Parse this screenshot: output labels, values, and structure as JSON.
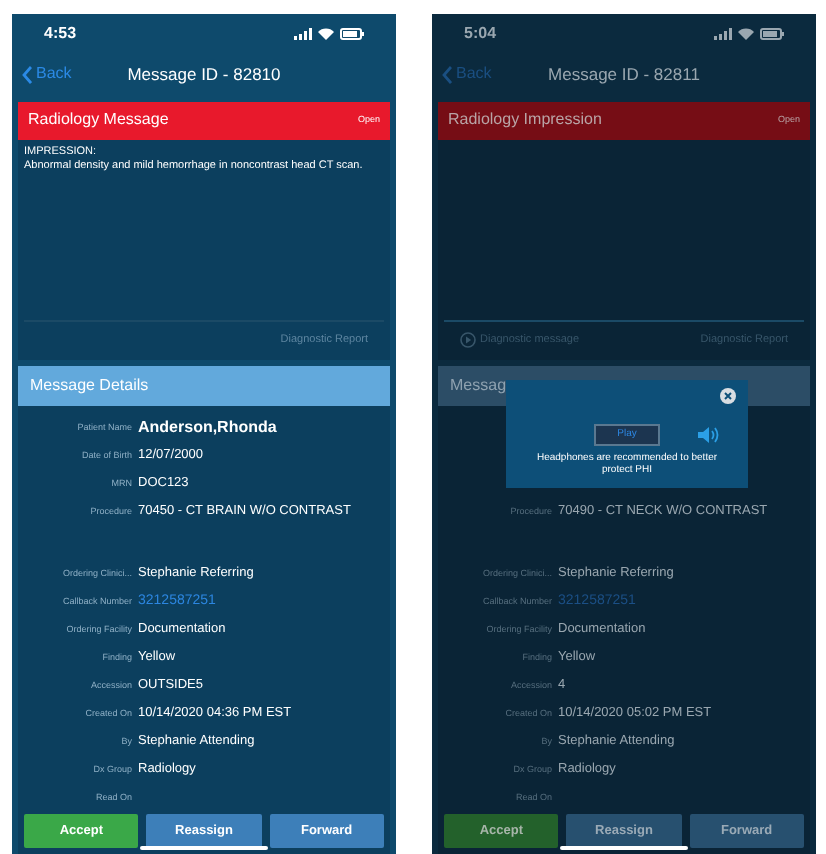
{
  "phones": [
    {
      "dimmed": false,
      "status_time": "4:53",
      "back_label": "Back",
      "title": "Message ID - 82810",
      "alert": {
        "title": "Radiology Message",
        "status": "Open"
      },
      "body_lines": [
        "IMPRESSION:",
        "Abnormal density and mild hemorrhage in noncontrast head CT scan."
      ],
      "footer_links": [
        {
          "kind": "report",
          "label": "Diagnostic Report"
        }
      ],
      "details_title": "Message Details",
      "detail_groups": [
        [
          {
            "kind": "name",
            "label": "Patient Name",
            "value": "Anderson,Rhonda"
          },
          {
            "kind": "text",
            "label": "Date of Birth",
            "value": "12/07/2000"
          },
          {
            "kind": "text",
            "label": "MRN",
            "value": "DOC123"
          },
          {
            "kind": "text",
            "label": "Procedure",
            "value": "70450 - CT BRAIN W/O CONTRAST"
          }
        ],
        [
          {
            "kind": "text",
            "label": "Ordering Clinici...",
            "value": "Stephanie Referring"
          },
          {
            "kind": "link",
            "label": "Callback Number",
            "value": "3212587251"
          },
          {
            "kind": "text",
            "label": "Ordering Facility",
            "value": "Documentation"
          },
          {
            "kind": "text",
            "label": "Finding",
            "value": "Yellow"
          },
          {
            "kind": "text",
            "label": "Accession",
            "value": "OUTSIDE5"
          },
          {
            "kind": "text",
            "label": "Created On",
            "value": "10/14/2020 04:36 PM EST"
          },
          {
            "kind": "text",
            "label": "By",
            "value": "Stephanie Attending"
          },
          {
            "kind": "text",
            "label": "Dx Group",
            "value": "Radiology"
          },
          {
            "kind": "text",
            "label": "Read On"
          }
        ]
      ],
      "buttons": [
        {
          "kind": "accept",
          "label": "Accept"
        },
        {
          "kind": "action",
          "label": "Reassign"
        },
        {
          "kind": "action",
          "label": "Forward"
        }
      ]
    },
    {
      "dimmed": true,
      "status_time": "5:04",
      "back_label": "Back",
      "title": "Message ID - 82811",
      "alert": {
        "title": "Radiology Impression",
        "status": "Open"
      },
      "footer_links": [
        {
          "kind": "audio",
          "label": "Diagnostic message"
        },
        {
          "kind": "report",
          "label": "Diagnostic Report"
        }
      ],
      "details_title": "Messag",
      "detail_groups": [
        [
          {
            "kind": "text",
            "label": "Procedure",
            "value": "70490 - CT NECK W/O CONTRAST"
          }
        ],
        [
          {
            "kind": "text",
            "label": "Ordering Clinici...",
            "value": "Stephanie Referring"
          },
          {
            "kind": "link",
            "label": "Callback Number",
            "value": "3212587251"
          },
          {
            "kind": "text",
            "label": "Ordering Facility",
            "value": "Documentation"
          },
          {
            "kind": "text",
            "label": "Finding",
            "value": "Yellow"
          },
          {
            "kind": "text",
            "label": "Accession",
            "value": "4"
          },
          {
            "kind": "text",
            "label": "Created On",
            "value": "10/14/2020 05:02 PM EST"
          },
          {
            "kind": "text",
            "label": "By",
            "value": "Stephanie Attending"
          },
          {
            "kind": "text",
            "label": "Dx Group",
            "value": "Radiology"
          },
          {
            "kind": "text",
            "label": "Read On"
          }
        ]
      ],
      "buttons": [
        {
          "kind": "accept",
          "label": "Accept"
        },
        {
          "kind": "action",
          "label": "Reassign"
        },
        {
          "kind": "action",
          "label": "Forward"
        }
      ],
      "popup": {
        "play_label": "Play",
        "message": "Headphones are recommended to better protect PHI"
      }
    }
  ]
}
